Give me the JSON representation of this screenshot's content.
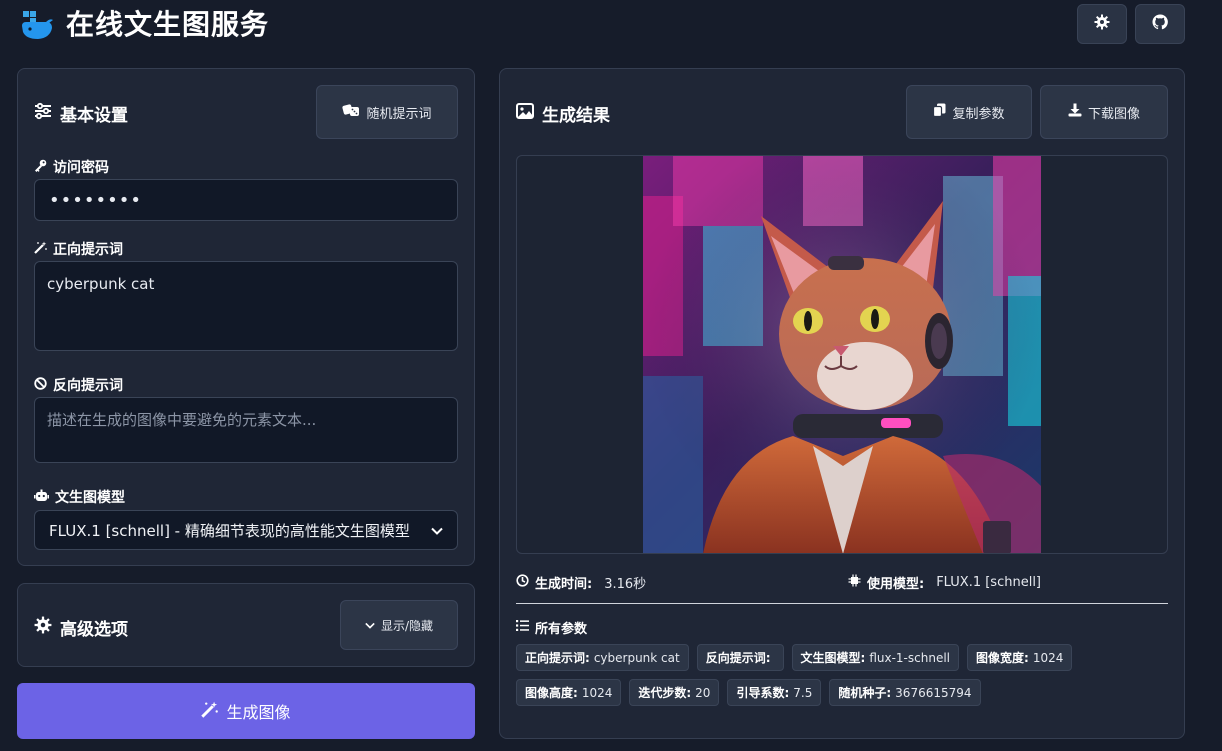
{
  "header": {
    "title": "在线文生图服务",
    "settings_icon": "gear-icon",
    "github_icon": "github-icon"
  },
  "basic": {
    "title": "基本设置",
    "random_prompt_label": "随机提示词",
    "password": {
      "label": "访问密码",
      "value": "••••••••"
    },
    "positive": {
      "label": "正向提示词",
      "value": "cyberpunk cat"
    },
    "negative": {
      "label": "反向提示词",
      "placeholder": "描述在生成的图像中要避免的元素文本..."
    },
    "model": {
      "label": "文生图模型",
      "selected": "FLUX.1 [schnell] - 精确细节表现的高性能文生图模型"
    }
  },
  "advanced": {
    "title": "高级选项",
    "toggle_label": "显示/隐藏"
  },
  "generate_label": "生成图像",
  "result": {
    "title": "生成结果",
    "copy_label": "复制参数",
    "download_label": "下载图像",
    "time_label": "生成时间:",
    "time_value": "3.16秒",
    "model_label": "使用模型:",
    "model_value": "FLUX.1 [schnell]",
    "params_title": "所有参数",
    "params": [
      {
        "key": "正向提示词:",
        "value": "cyberpunk cat"
      },
      {
        "key": "反向提示词:",
        "value": ""
      },
      {
        "key": "文生图模型:",
        "value": "flux-1-schnell"
      },
      {
        "key": "图像宽度:",
        "value": "1024"
      },
      {
        "key": "图像高度:",
        "value": "1024"
      },
      {
        "key": "迭代步数:",
        "value": "20"
      },
      {
        "key": "引导系数:",
        "value": "7.5"
      },
      {
        "key": "随机种子:",
        "value": "3676615794"
      }
    ]
  },
  "colors": {
    "background": "#161c2a",
    "panel": "#1f2636",
    "accent": "#6c63e6"
  }
}
